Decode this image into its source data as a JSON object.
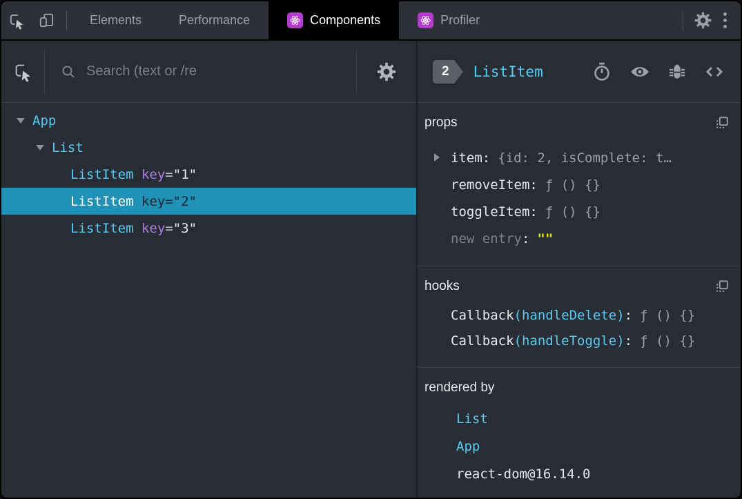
{
  "colors": {
    "window_bg": "#282c34",
    "tabbar_bg": "#2d3036",
    "active_tab_bg": "#000000",
    "component_cyan": "#57ccf2",
    "attr_purple": "#ac7ede",
    "selected_row_bg": "#2092b8",
    "react_badge_purple": "#b23ccb",
    "value_gray": "#9aa0a6",
    "editable_yellow": "#e5e510",
    "owner_badge_gray": "#5c6167",
    "divider_gray": "#3f444b"
  },
  "tabbar": {
    "tabs": [
      {
        "label": "Elements"
      },
      {
        "label": "Performance"
      },
      {
        "label": "Components"
      },
      {
        "label": "Profiler"
      }
    ]
  },
  "left": {
    "search": {
      "placeholder": "Search (text or /re"
    },
    "tree": {
      "rows": [
        {
          "name": "App"
        },
        {
          "name": "List"
        },
        {
          "name": "ListItem",
          "attr": "key",
          "eq": "=",
          "value": "\"1\""
        },
        {
          "name": "ListItem",
          "attr": "key",
          "eq": "=",
          "value": "\"2\""
        },
        {
          "name": "ListItem",
          "attr": "key",
          "eq": "=",
          "value": "\"3\""
        }
      ]
    }
  },
  "right": {
    "header": {
      "badge": "2",
      "title": "ListItem"
    },
    "props": {
      "title": "props",
      "rows": [
        {
          "key": "item",
          "sep": ":",
          "value": "{id: 2, isComplete: t…"
        },
        {
          "key": "removeItem",
          "sep": ":",
          "value": "ƒ () {}"
        },
        {
          "key": "toggleItem",
          "sep": ":",
          "value": "ƒ () {}"
        },
        {
          "key": "new entry",
          "sep": ":",
          "value": "\"\""
        }
      ]
    },
    "hooks": {
      "title": "hooks",
      "rows": [
        {
          "fn": "Callback",
          "arg": "(handleDelete)",
          "sep": ":",
          "value": "ƒ () {}"
        },
        {
          "fn": "Callback",
          "arg": "(handleToggle)",
          "sep": ":",
          "value": "ƒ () {}"
        }
      ]
    },
    "rendered_by": {
      "title": "rendered by",
      "items": [
        {
          "label": "List"
        },
        {
          "label": "App"
        },
        {
          "label": "react-dom@16.14.0"
        }
      ]
    }
  }
}
